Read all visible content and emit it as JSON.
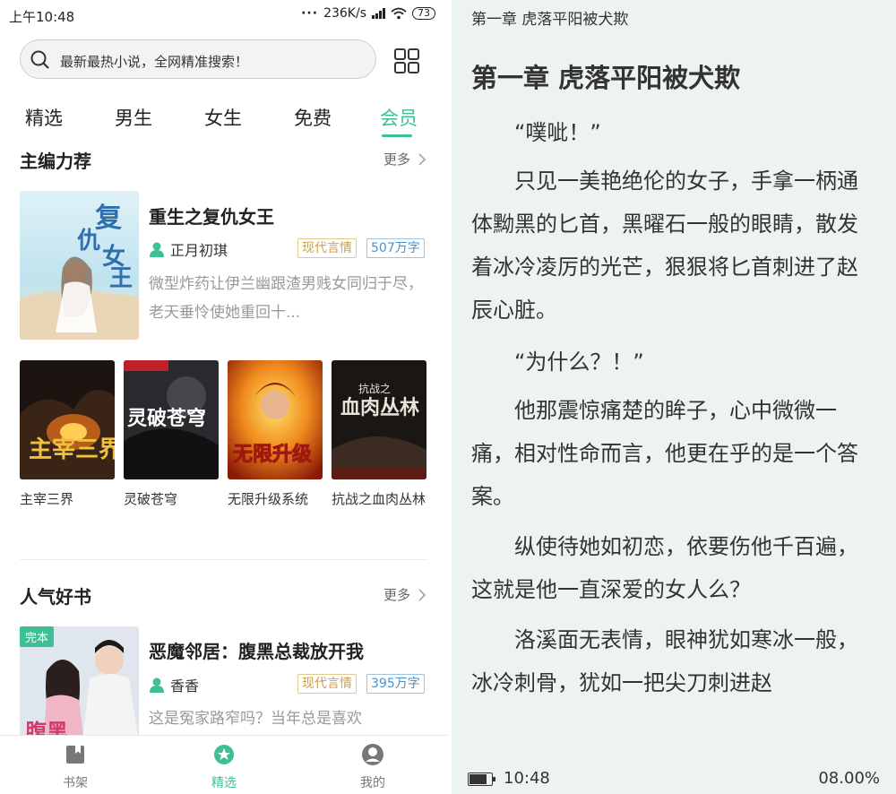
{
  "status_bar": {
    "time": "上午10:48",
    "speed": "236K/s",
    "battery": "73"
  },
  "search": {
    "placeholder": "最新最热小说，全网精准搜索！"
  },
  "tabs": [
    {
      "label": "精选"
    },
    {
      "label": "男生"
    },
    {
      "label": "女生"
    },
    {
      "label": "免费"
    },
    {
      "label": "会员"
    }
  ],
  "active_tab": "会员",
  "section_featured": {
    "title": "主编力荐",
    "more": "更多"
  },
  "featured_book": {
    "title": "重生之复仇女王",
    "author": "正月初琪",
    "genre": "现代言情",
    "words": "507万字",
    "desc": "微型炸药让伊兰幽跟渣男贱女同归于尽，老天垂怜使她重回十..."
  },
  "grid_books": [
    {
      "title": "主宰三界"
    },
    {
      "title": "灵破苍穹"
    },
    {
      "title": "无限升级系统"
    },
    {
      "title": "抗战之血肉丛林"
    }
  ],
  "section_popular": {
    "title": "人气好书",
    "more": "更多"
  },
  "popular_book": {
    "badge": "完本",
    "title": "恶魔邻居：腹黑总裁放开我",
    "author": "香香",
    "genre": "现代言情",
    "words": "395万字",
    "desc": "这是冤家路窄吗？当年总是喜欢"
  },
  "bottom_nav": [
    {
      "label": "书架",
      "icon": "bookshelf-icon"
    },
    {
      "label": "精选",
      "icon": "featured-icon"
    },
    {
      "label": "我的",
      "icon": "profile-icon"
    }
  ],
  "colors": {
    "accent": "#3fbf94",
    "reader_bg": "#edf3f2"
  },
  "reader": {
    "header": "第一章 虎落平阳被犬欺",
    "title": "第一章 虎落平阳被犬欺",
    "paragraphs": [
      "“噗呲！”",
      "只见一美艳绝伦的女子，手拿一柄通体黝黑的匕首，黑曜石一般的眼睛，散发着冰冷凌厉的光芒，狠狠将匕首刺进了赵辰心脏。",
      "“为什么？！”",
      "他那震惊痛楚的眸子，心中微微一痛，相对性命而言，他更在乎的是一个答案。",
      "纵使待她如初恋，依要伤他千百遍，这就是他一直深爱的女人么？",
      "洛溪面无表情，眼神犹如寒冰一般，冰冷刺骨，犹如一把尖刀刺进赵"
    ],
    "footer_time": "10:48",
    "progress": "08.00%"
  }
}
